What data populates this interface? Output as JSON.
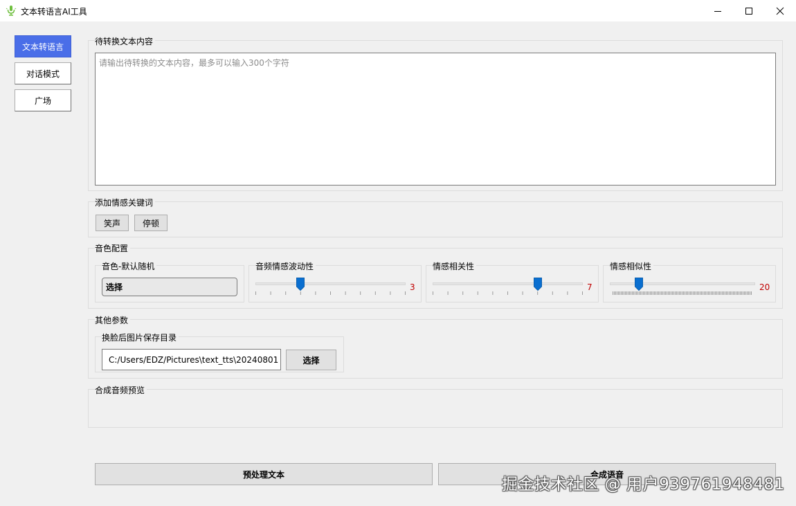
{
  "window": {
    "title": "文本转语言AI工具",
    "icon": "microphone-icon"
  },
  "nav": {
    "items": [
      {
        "label": "文本转语言",
        "active": true
      },
      {
        "label": "对话模式",
        "active": false
      },
      {
        "label": "广场",
        "active": false
      }
    ]
  },
  "text_section": {
    "title": "待转换文本内容",
    "value": "",
    "placeholder": "请输出待转换的文本内容，最多可以输入300个字符"
  },
  "keywords": {
    "title": "添加情感关键词",
    "buttons": [
      "笑声",
      "停顿"
    ]
  },
  "voice_config": {
    "title": "音色配置",
    "voice": {
      "title": "音色-默认随机",
      "button_label": "选择"
    },
    "sliders": [
      {
        "title": "音频情感波动性",
        "value": "3",
        "min": 0,
        "max": 10
      },
      {
        "title": "情感相关性",
        "value": "7",
        "min": 0,
        "max": 10
      },
      {
        "title": "情感相似性",
        "value": "20",
        "min": 0,
        "max": 100
      }
    ]
  },
  "other_params": {
    "title": "其他参数",
    "save_dir": {
      "title": "换脸后图片保存目录",
      "value": "C:/Users/EDZ/Pictures\\text_tts\\20240801",
      "button_label": "选择"
    }
  },
  "preview": {
    "title": "合成音频预览"
  },
  "actions": {
    "preprocess_label": "预处理文本",
    "synthesize_label": "合成语音"
  },
  "watermark": "掘金技术社区 @ 用户939761948481",
  "colors": {
    "accent": "#4a6ee8",
    "slider_thumb": "#0a6fd0",
    "slider_value": "#c00000"
  }
}
